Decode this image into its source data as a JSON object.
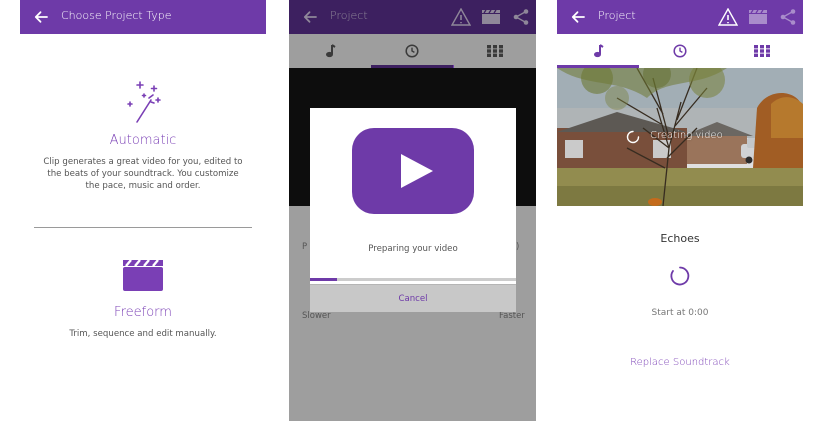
{
  "colors": {
    "accent": "#6e3aa8",
    "text_muted": "#555555",
    "white": "#ffffff"
  },
  "screen1": {
    "appbar": {
      "title": "Choose Project Type"
    },
    "automatic": {
      "heading": "Automatic",
      "description": "Clip generates a great video for you, edited to the beats of your soundtrack. You customize the pace, music and order."
    },
    "freeform": {
      "heading": "Freeform",
      "description": "Trim, sequence and edit manually."
    }
  },
  "screen2": {
    "appbar": {
      "title": "Project"
    },
    "tabs": [
      {
        "icon": "music-note-icon"
      },
      {
        "icon": "clock-icon",
        "active": true
      },
      {
        "icon": "grid-icon"
      }
    ],
    "background": {
      "left_letter": "P",
      "right_letter": ")",
      "slower": "Slower",
      "faster": "Faster"
    },
    "dialog": {
      "message": "Preparing your video",
      "progress_fraction": 0.13,
      "cancel_label": "Cancel"
    }
  },
  "screen3": {
    "appbar": {
      "title": "Project"
    },
    "tabs": [
      {
        "icon": "music-note-icon",
        "active": true
      },
      {
        "icon": "clock-icon"
      },
      {
        "icon": "grid-icon"
      }
    ],
    "preview": {
      "status": "Creating video"
    },
    "song_title": "Echoes",
    "start_label": "Start at 0:00",
    "replace_label": "Replace Soundtrack"
  }
}
